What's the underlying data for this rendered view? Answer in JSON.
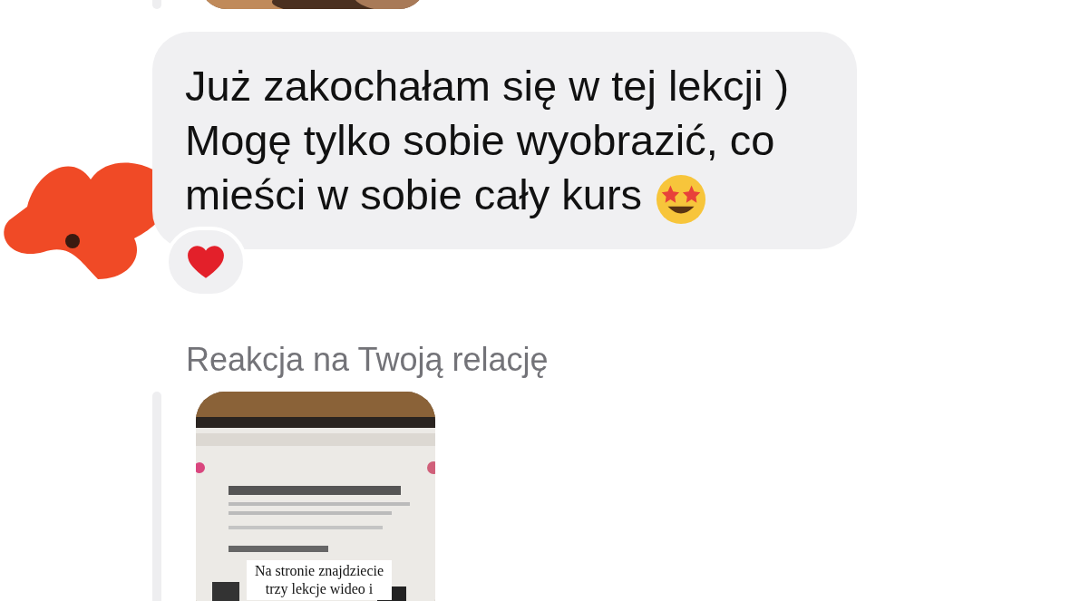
{
  "messages": [
    {
      "kind": "picture"
    },
    {
      "kind": "text",
      "lines": [
        "Już zakochałam się w tej lekcji )",
        "Mogę tylko sobie wyobrazić, co",
        "mieści w sobie cały kurs"
      ],
      "starstruck_emoji": true,
      "heart_reaction": true
    },
    {
      "kind": "story_reply",
      "label": "Reakcja na Twoją relację",
      "caption": "Na stronie znajdziecie\ntrzy lekcje wideo i"
    }
  ]
}
